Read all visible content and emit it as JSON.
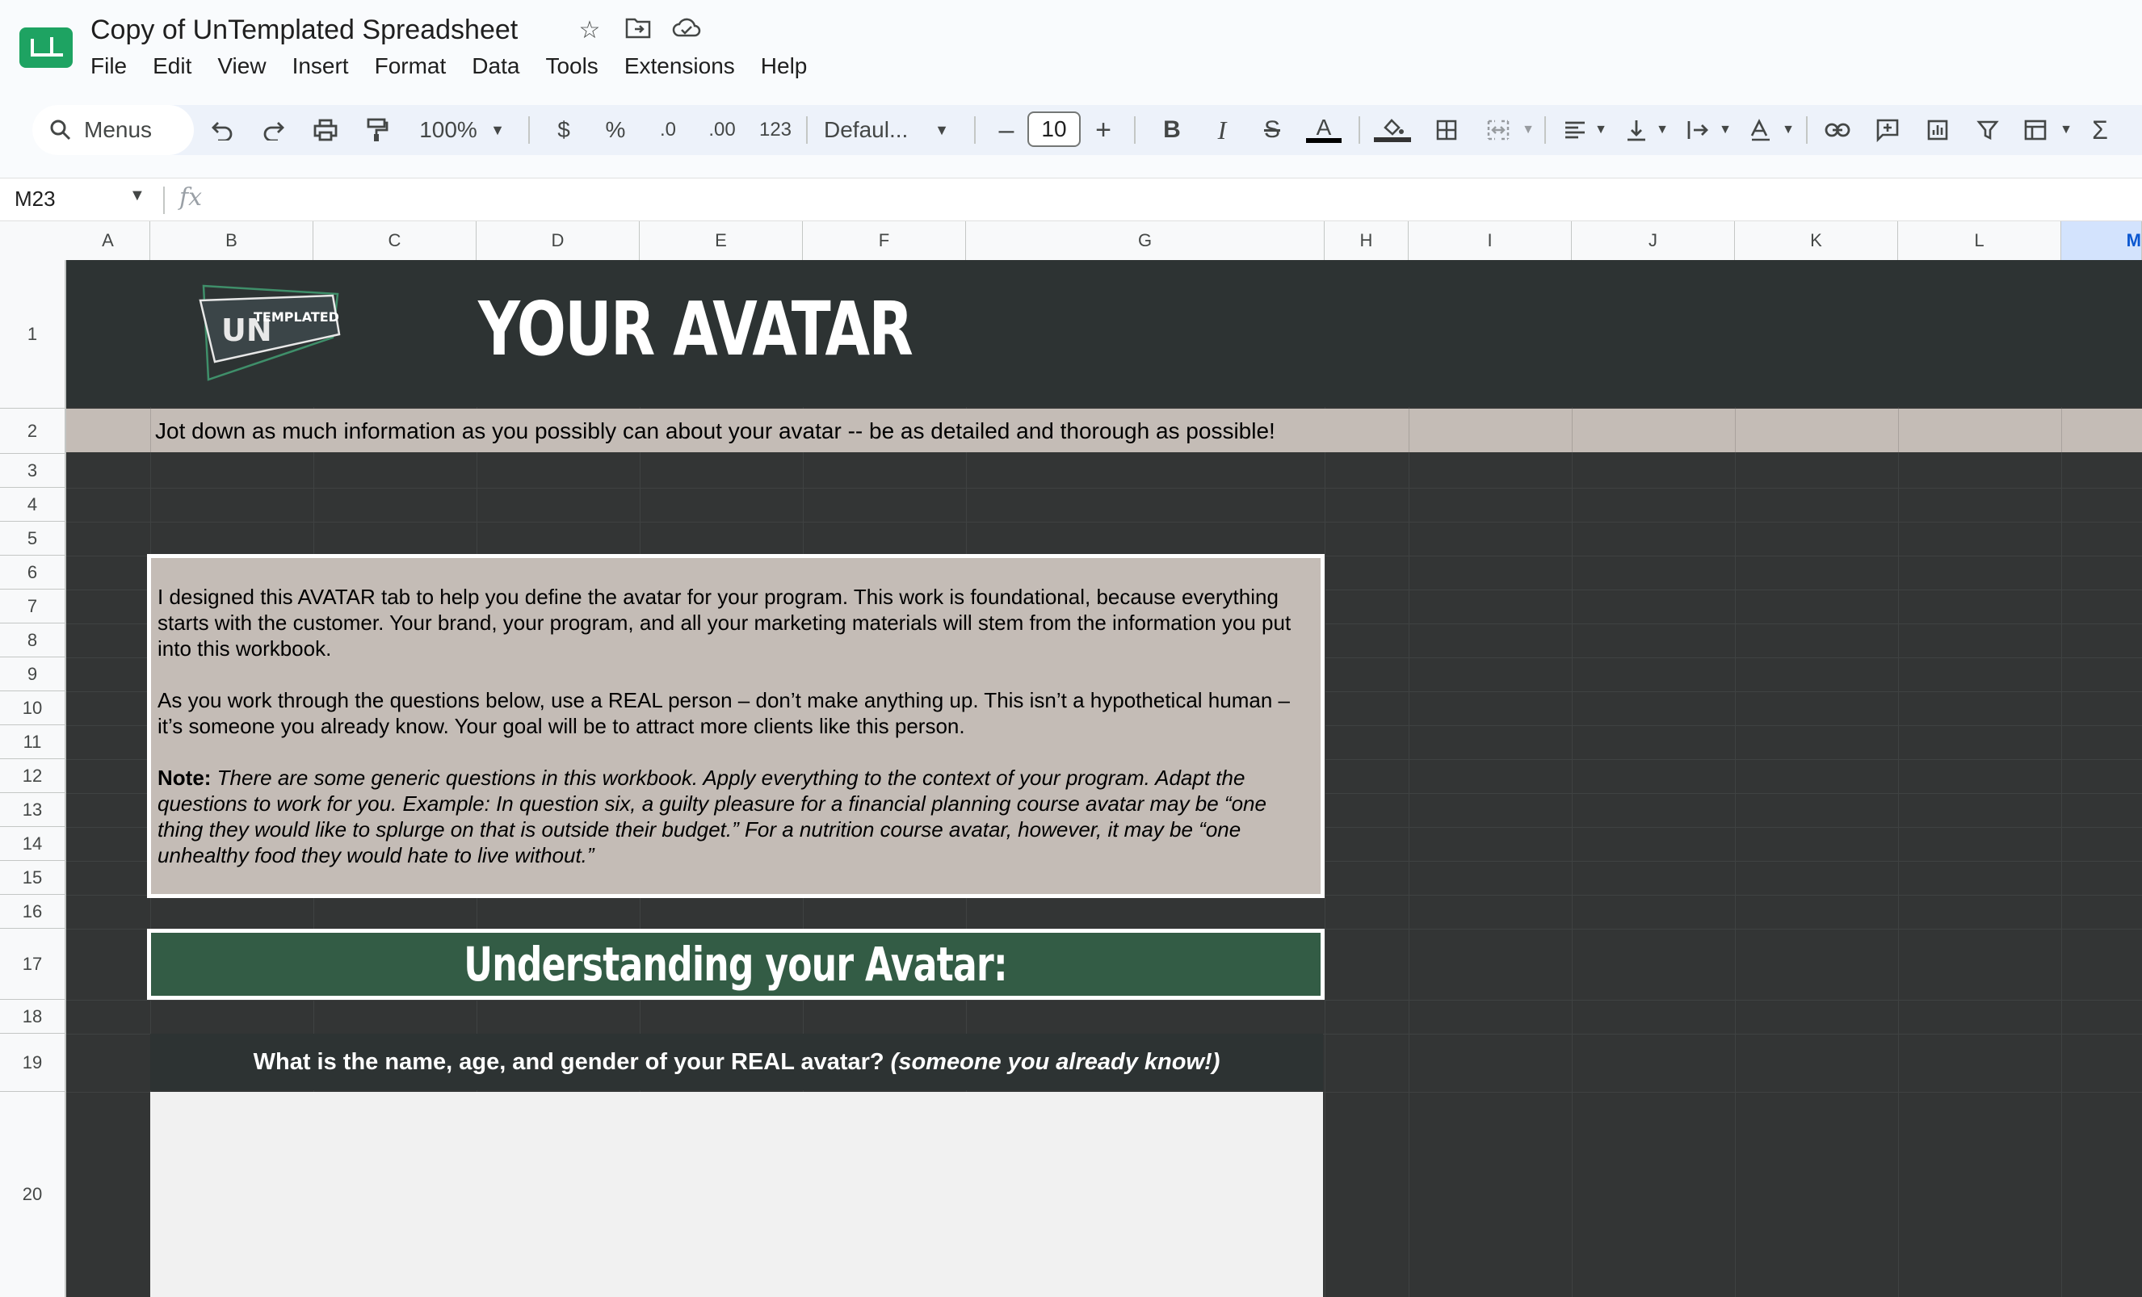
{
  "app": {
    "doc_title": "Copy of UnTemplated Spreadsheet",
    "icons": [
      "star-icon",
      "move-to-folder-icon",
      "cloud-status-icon"
    ]
  },
  "menu": [
    "File",
    "Edit",
    "View",
    "Insert",
    "Format",
    "Data",
    "Tools",
    "Extensions",
    "Help"
  ],
  "toolbar": {
    "search_label": "Menus",
    "zoom": "100%",
    "currency": "$",
    "percent": "%",
    "dec_decrease": ".0",
    "dec_increase": ".00",
    "number_format": "123",
    "font_name": "Defaul...",
    "font_size": "10"
  },
  "formula_bar": {
    "cell_ref": "M23",
    "fx": "fx"
  },
  "columns": [
    "A",
    "B",
    "C",
    "D",
    "E",
    "F",
    "G",
    "H",
    "I",
    "J",
    "K",
    "L",
    "M"
  ],
  "rows": [
    "1",
    "2",
    "3",
    "4",
    "5",
    "6",
    "7",
    "8",
    "9",
    "10",
    "11",
    "12",
    "13",
    "14",
    "15",
    "16",
    "17",
    "18",
    "19",
    "20"
  ],
  "sheet": {
    "logo_text_un": "UN",
    "logo_text_templated": "TEMPLATED",
    "title": "YOUR AVATAR",
    "subtitle": "Jot down as much information as you possibly can about your avatar -- be as detailed and thorough as possible!",
    "intro_p1": "I designed this AVATAR tab to help you define the avatar for your program. This work is foundational, because everything starts with the customer. Your brand, your program, and all your marketing materials will stem from the information you put into this workbook.",
    "intro_p2": "As you work through the questions below, use a REAL person – don’t make anything up. This isn’t a hypothetical human – it’s someone you already know. Your goal will be to attract more clients like this person.",
    "note_label": "Note:",
    "note_body": "There are some generic questions in this workbook. Apply everything to the context of your program. Adapt the questions to work for you. Example: In question six, a guilty pleasure for a financial planning course avatar may be “one thing they would like to splurge on that is outside their budget.” For a nutrition course avatar, however, it may be “one unhealthy food they would hate to live without.”",
    "section_heading": "Understanding your Avatar:",
    "question1_main": "What is the name, age, and gender of your REAL avatar?",
    "question1_em": "(someone you already know!)"
  },
  "colors": {
    "dark_band": "#2d3333",
    "grid_bg": "#333535",
    "taupe": "#c4bcb6",
    "section_green": "#335c45",
    "answer_bg": "#f1f1f1"
  }
}
